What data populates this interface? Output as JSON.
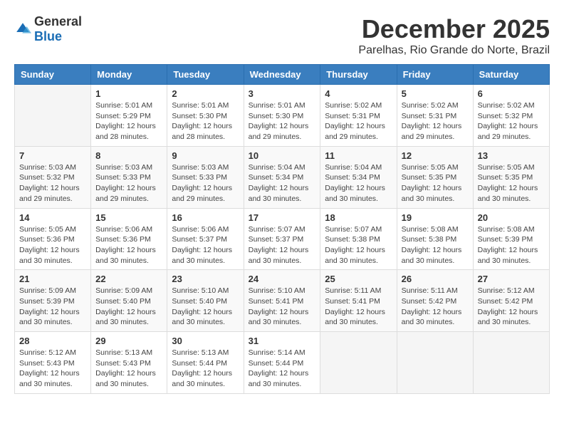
{
  "logo": {
    "general": "General",
    "blue": "Blue"
  },
  "header": {
    "month": "December 2025",
    "location": "Parelhas, Rio Grande do Norte, Brazil"
  },
  "weekdays": [
    "Sunday",
    "Monday",
    "Tuesday",
    "Wednesday",
    "Thursday",
    "Friday",
    "Saturday"
  ],
  "weeks": [
    [
      {
        "day": "",
        "info": ""
      },
      {
        "day": "1",
        "info": "Sunrise: 5:01 AM\nSunset: 5:29 PM\nDaylight: 12 hours\nand 28 minutes."
      },
      {
        "day": "2",
        "info": "Sunrise: 5:01 AM\nSunset: 5:30 PM\nDaylight: 12 hours\nand 28 minutes."
      },
      {
        "day": "3",
        "info": "Sunrise: 5:01 AM\nSunset: 5:30 PM\nDaylight: 12 hours\nand 29 minutes."
      },
      {
        "day": "4",
        "info": "Sunrise: 5:02 AM\nSunset: 5:31 PM\nDaylight: 12 hours\nand 29 minutes."
      },
      {
        "day": "5",
        "info": "Sunrise: 5:02 AM\nSunset: 5:31 PM\nDaylight: 12 hours\nand 29 minutes."
      },
      {
        "day": "6",
        "info": "Sunrise: 5:02 AM\nSunset: 5:32 PM\nDaylight: 12 hours\nand 29 minutes."
      }
    ],
    [
      {
        "day": "7",
        "info": "Sunrise: 5:03 AM\nSunset: 5:32 PM\nDaylight: 12 hours\nand 29 minutes."
      },
      {
        "day": "8",
        "info": "Sunrise: 5:03 AM\nSunset: 5:33 PM\nDaylight: 12 hours\nand 29 minutes."
      },
      {
        "day": "9",
        "info": "Sunrise: 5:03 AM\nSunset: 5:33 PM\nDaylight: 12 hours\nand 29 minutes."
      },
      {
        "day": "10",
        "info": "Sunrise: 5:04 AM\nSunset: 5:34 PM\nDaylight: 12 hours\nand 30 minutes."
      },
      {
        "day": "11",
        "info": "Sunrise: 5:04 AM\nSunset: 5:34 PM\nDaylight: 12 hours\nand 30 minutes."
      },
      {
        "day": "12",
        "info": "Sunrise: 5:05 AM\nSunset: 5:35 PM\nDaylight: 12 hours\nand 30 minutes."
      },
      {
        "day": "13",
        "info": "Sunrise: 5:05 AM\nSunset: 5:35 PM\nDaylight: 12 hours\nand 30 minutes."
      }
    ],
    [
      {
        "day": "14",
        "info": "Sunrise: 5:05 AM\nSunset: 5:36 PM\nDaylight: 12 hours\nand 30 minutes."
      },
      {
        "day": "15",
        "info": "Sunrise: 5:06 AM\nSunset: 5:36 PM\nDaylight: 12 hours\nand 30 minutes."
      },
      {
        "day": "16",
        "info": "Sunrise: 5:06 AM\nSunset: 5:37 PM\nDaylight: 12 hours\nand 30 minutes."
      },
      {
        "day": "17",
        "info": "Sunrise: 5:07 AM\nSunset: 5:37 PM\nDaylight: 12 hours\nand 30 minutes."
      },
      {
        "day": "18",
        "info": "Sunrise: 5:07 AM\nSunset: 5:38 PM\nDaylight: 12 hours\nand 30 minutes."
      },
      {
        "day": "19",
        "info": "Sunrise: 5:08 AM\nSunset: 5:38 PM\nDaylight: 12 hours\nand 30 minutes."
      },
      {
        "day": "20",
        "info": "Sunrise: 5:08 AM\nSunset: 5:39 PM\nDaylight: 12 hours\nand 30 minutes."
      }
    ],
    [
      {
        "day": "21",
        "info": "Sunrise: 5:09 AM\nSunset: 5:39 PM\nDaylight: 12 hours\nand 30 minutes."
      },
      {
        "day": "22",
        "info": "Sunrise: 5:09 AM\nSunset: 5:40 PM\nDaylight: 12 hours\nand 30 minutes."
      },
      {
        "day": "23",
        "info": "Sunrise: 5:10 AM\nSunset: 5:40 PM\nDaylight: 12 hours\nand 30 minutes."
      },
      {
        "day": "24",
        "info": "Sunrise: 5:10 AM\nSunset: 5:41 PM\nDaylight: 12 hours\nand 30 minutes."
      },
      {
        "day": "25",
        "info": "Sunrise: 5:11 AM\nSunset: 5:41 PM\nDaylight: 12 hours\nand 30 minutes."
      },
      {
        "day": "26",
        "info": "Sunrise: 5:11 AM\nSunset: 5:42 PM\nDaylight: 12 hours\nand 30 minutes."
      },
      {
        "day": "27",
        "info": "Sunrise: 5:12 AM\nSunset: 5:42 PM\nDaylight: 12 hours\nand 30 minutes."
      }
    ],
    [
      {
        "day": "28",
        "info": "Sunrise: 5:12 AM\nSunset: 5:43 PM\nDaylight: 12 hours\nand 30 minutes."
      },
      {
        "day": "29",
        "info": "Sunrise: 5:13 AM\nSunset: 5:43 PM\nDaylight: 12 hours\nand 30 minutes."
      },
      {
        "day": "30",
        "info": "Sunrise: 5:13 AM\nSunset: 5:44 PM\nDaylight: 12 hours\nand 30 minutes."
      },
      {
        "day": "31",
        "info": "Sunrise: 5:14 AM\nSunset: 5:44 PM\nDaylight: 12 hours\nand 30 minutes."
      },
      {
        "day": "",
        "info": ""
      },
      {
        "day": "",
        "info": ""
      },
      {
        "day": "",
        "info": ""
      }
    ]
  ]
}
